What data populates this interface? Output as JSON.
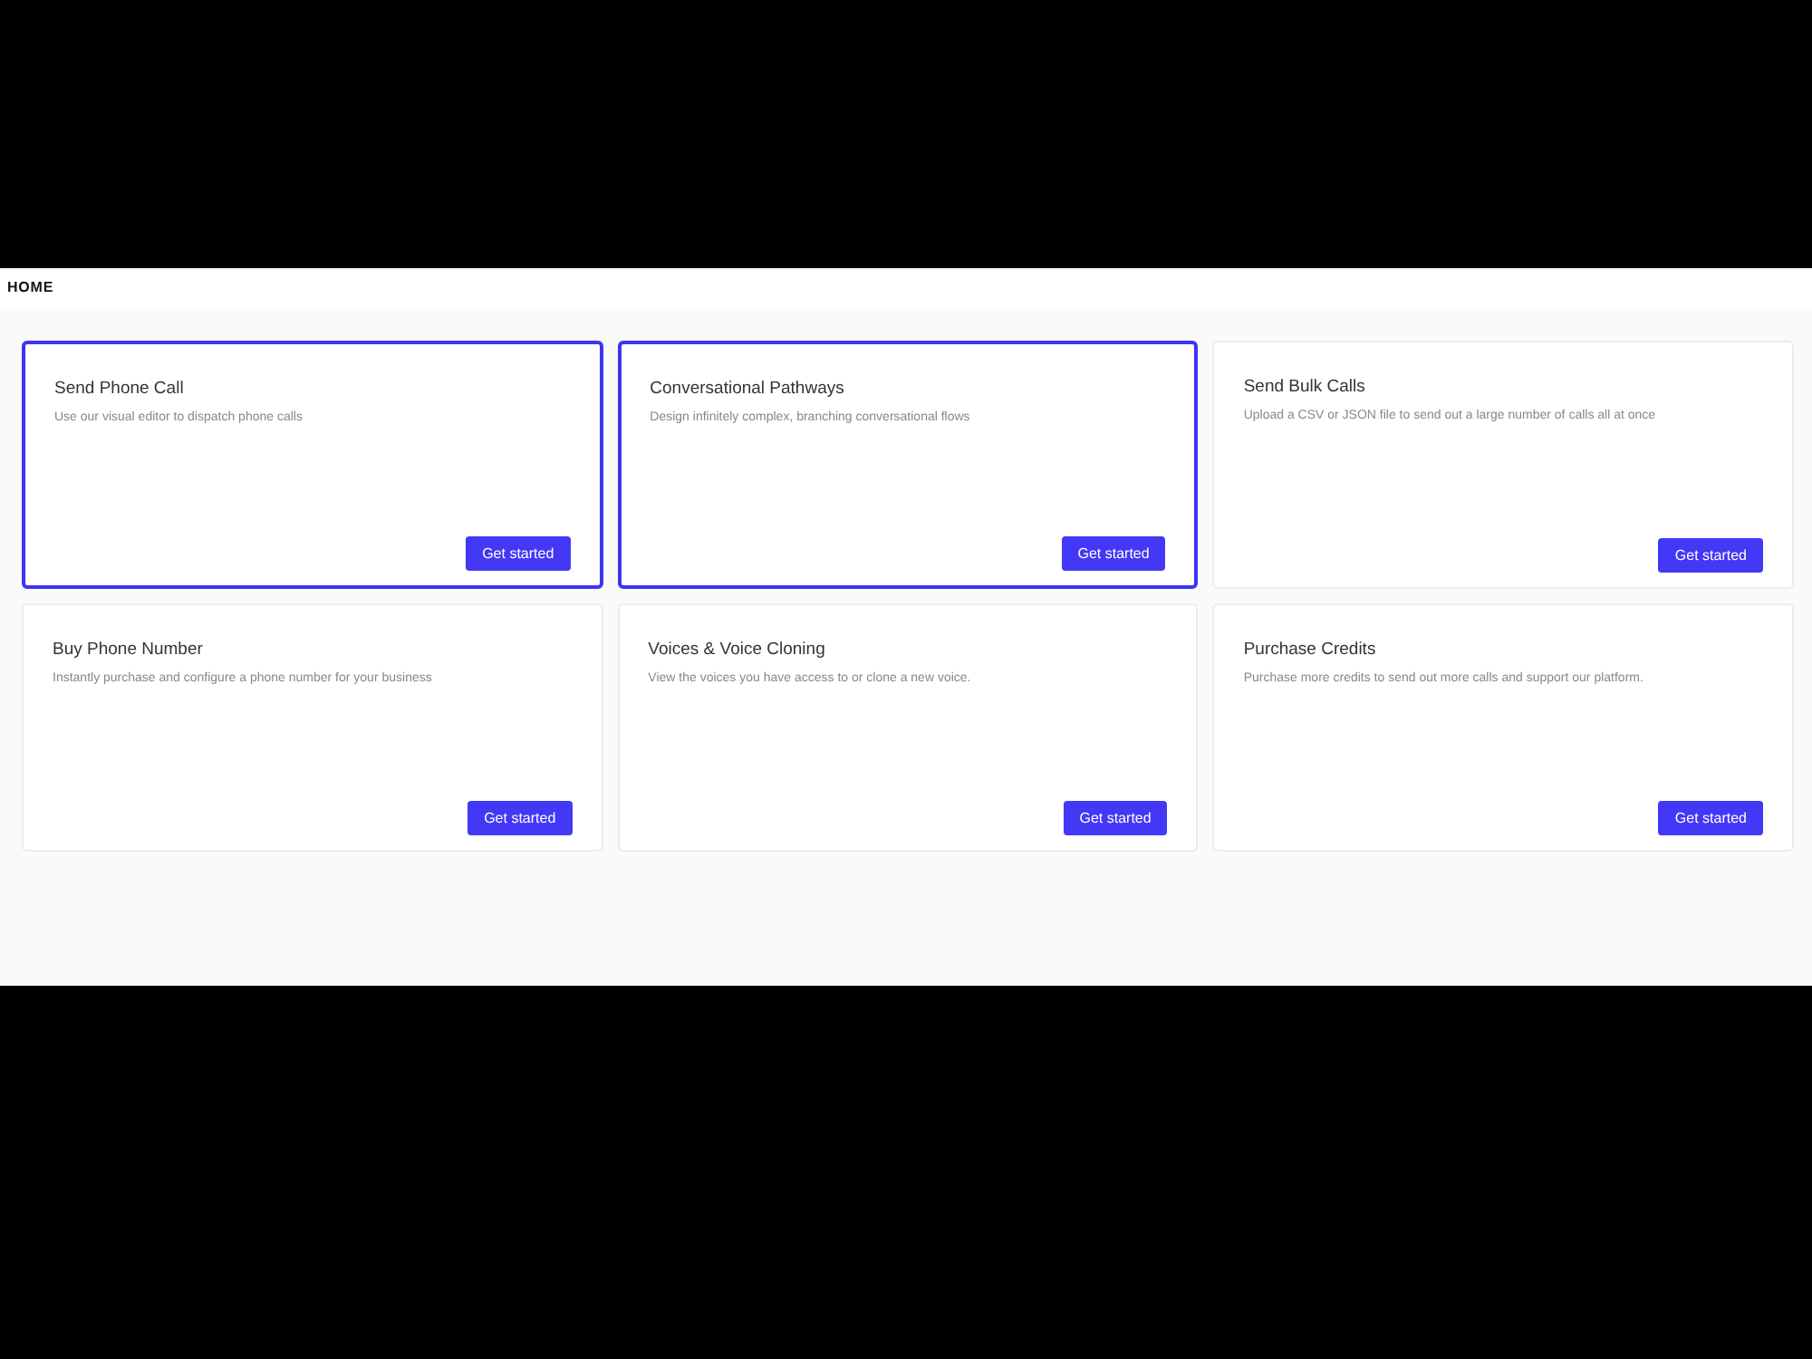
{
  "header": {
    "title": "HOME"
  },
  "cards": [
    {
      "title": "Send Phone Call",
      "description": "Use our visual editor to dispatch phone calls",
      "button": "Get started",
      "highlighted": true
    },
    {
      "title": "Conversational Pathways",
      "description": "Design infinitely complex, branching conversational flows",
      "button": "Get started",
      "highlighted": true
    },
    {
      "title": "Send Bulk Calls",
      "description": "Upload a CSV or JSON file to send out a large number of calls all at once",
      "button": "Get started",
      "highlighted": false
    },
    {
      "title": "Buy Phone Number",
      "description": "Instantly purchase and configure a phone number for your business",
      "button": "Get started",
      "highlighted": false
    },
    {
      "title": "Voices & Voice Cloning",
      "description": "View the voices you have access to or clone a new voice.",
      "button": "Get started",
      "highlighted": false
    },
    {
      "title": "Purchase Credits",
      "description": "Purchase more credits to send out more calls and support our platform.",
      "button": "Get started",
      "highlighted": false
    }
  ]
}
